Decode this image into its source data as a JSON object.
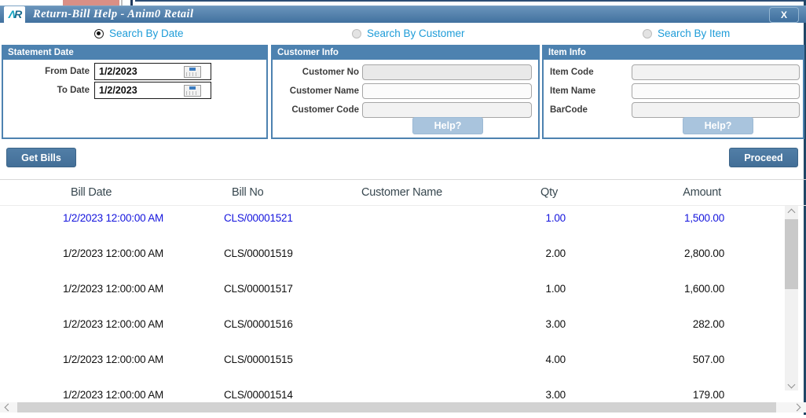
{
  "window": {
    "logo_text_left": "Λ",
    "logo_text_right": "R",
    "title": "Return-Bill Help - Anim0 Retail",
    "close_label": "X"
  },
  "search_modes": [
    {
      "label": "Search By Date",
      "selected": true
    },
    {
      "label": "Search By Customer",
      "selected": false
    },
    {
      "label": "Search By Item",
      "selected": false
    }
  ],
  "statement_date": {
    "header": "Statement Date",
    "rows": [
      {
        "label": "From Date",
        "value": "1/2/2023"
      },
      {
        "label": "To Date",
        "value": "1/2/2023"
      }
    ]
  },
  "customer_info": {
    "header": "Customer Info",
    "fields": [
      {
        "label": "Customer No",
        "value": ""
      },
      {
        "label": "Customer Name",
        "value": ""
      },
      {
        "label": "Customer Code",
        "value": ""
      }
    ],
    "help_label": "Help?"
  },
  "item_info": {
    "header": "Item Info",
    "fields": [
      {
        "label": "Item Code",
        "value": ""
      },
      {
        "label": "Item Name",
        "value": ""
      },
      {
        "label": "BarCode",
        "value": ""
      }
    ],
    "help_label": "Help?"
  },
  "actions": {
    "get_bills_label": "Get Bills",
    "proceed_label": "Proceed"
  },
  "table": {
    "columns": [
      "Bill Date",
      "Bill No",
      "Customer Name",
      "Qty",
      "Amount"
    ],
    "rows": [
      {
        "bill_date": "1/2/2023 12:00:00 AM",
        "bill_no": "CLS/00001521",
        "customer_name": "",
        "qty": "1.00",
        "amount": "1,500.00",
        "selected": true
      },
      {
        "bill_date": "1/2/2023 12:00:00 AM",
        "bill_no": "CLS/00001519",
        "customer_name": "",
        "qty": "2.00",
        "amount": "2,800.00",
        "selected": false
      },
      {
        "bill_date": "1/2/2023 12:00:00 AM",
        "bill_no": "CLS/00001517",
        "customer_name": "",
        "qty": "1.00",
        "amount": "1,600.00",
        "selected": false
      },
      {
        "bill_date": "1/2/2023 12:00:00 AM",
        "bill_no": "CLS/00001516",
        "customer_name": "",
        "qty": "3.00",
        "amount": "282.00",
        "selected": false
      },
      {
        "bill_date": "1/2/2023 12:00:00 AM",
        "bill_no": "CLS/00001515",
        "customer_name": "",
        "qty": "4.00",
        "amount": "507.00",
        "selected": false
      },
      {
        "bill_date": "1/2/2023 12:00:00 AM",
        "bill_no": "CLS/00001514",
        "customer_name": "",
        "qty": "3.00",
        "amount": "179.00",
        "selected": false
      }
    ]
  },
  "colors": {
    "titlebar_top": "#6a94bb",
    "titlebar_bottom": "#41719f",
    "group_header": "#4d82b0",
    "radio_label": "#1e9cd8",
    "primary_button": "#48759d",
    "help_button": "#a9c4dd",
    "selected_row_text": "#1414dd"
  }
}
